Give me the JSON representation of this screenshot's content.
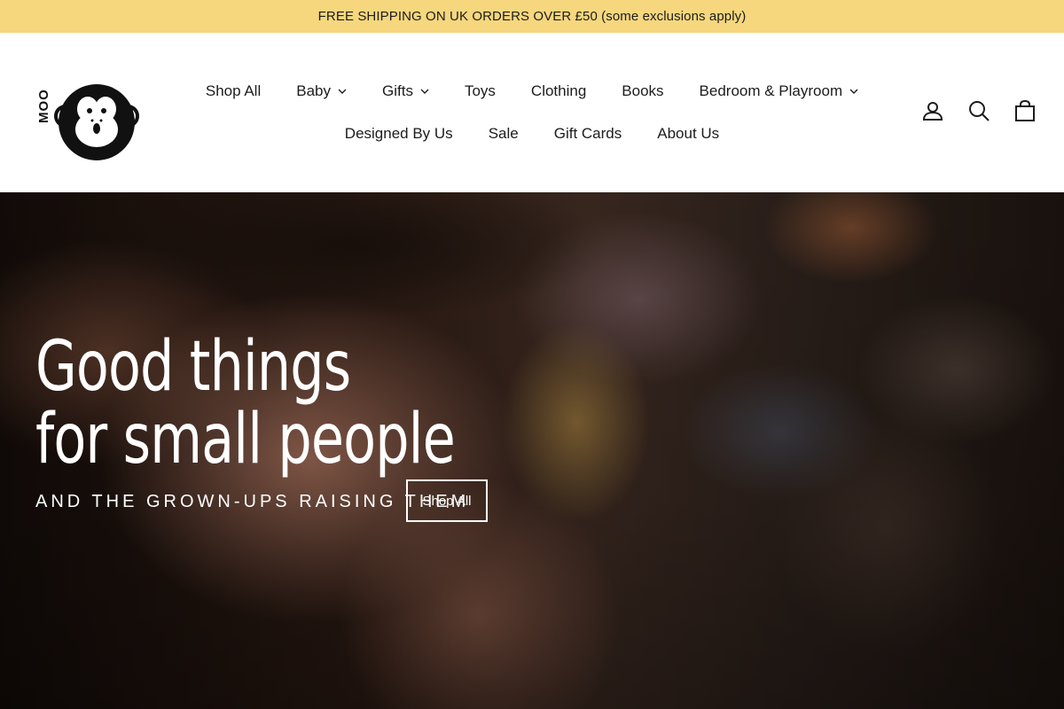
{
  "announcement": {
    "text": "FREE SHIPPING ON UK ORDERS OVER £50 (some exclusions apply)"
  },
  "logo": {
    "text": "MOO",
    "icon": "monkey-face-icon"
  },
  "nav": {
    "row1": [
      {
        "label": "Shop All",
        "dropdown": false
      },
      {
        "label": "Baby",
        "dropdown": true
      },
      {
        "label": "Gifts",
        "dropdown": true
      },
      {
        "label": "Toys",
        "dropdown": false
      },
      {
        "label": "Clothing",
        "dropdown": false
      },
      {
        "label": "Books",
        "dropdown": false
      },
      {
        "label": "Bedroom & Playroom",
        "dropdown": true
      }
    ],
    "row2": [
      {
        "label": "Designed By Us",
        "dropdown": false
      },
      {
        "label": "Sale",
        "dropdown": false
      },
      {
        "label": "Gift Cards",
        "dropdown": false
      },
      {
        "label": "About Us",
        "dropdown": false
      }
    ]
  },
  "header_icons": [
    "account-icon",
    "search-icon",
    "cart-icon"
  ],
  "hero": {
    "title_line1": "Good things",
    "title_line2": "for small people",
    "subtitle": "AND THE GROWN-UPS RAISING THEM",
    "cta_label": "Shop All"
  },
  "colors": {
    "announcement_bg": "#f6d77e",
    "text": "#1c1c1c",
    "hero_text": "#ffffff"
  }
}
